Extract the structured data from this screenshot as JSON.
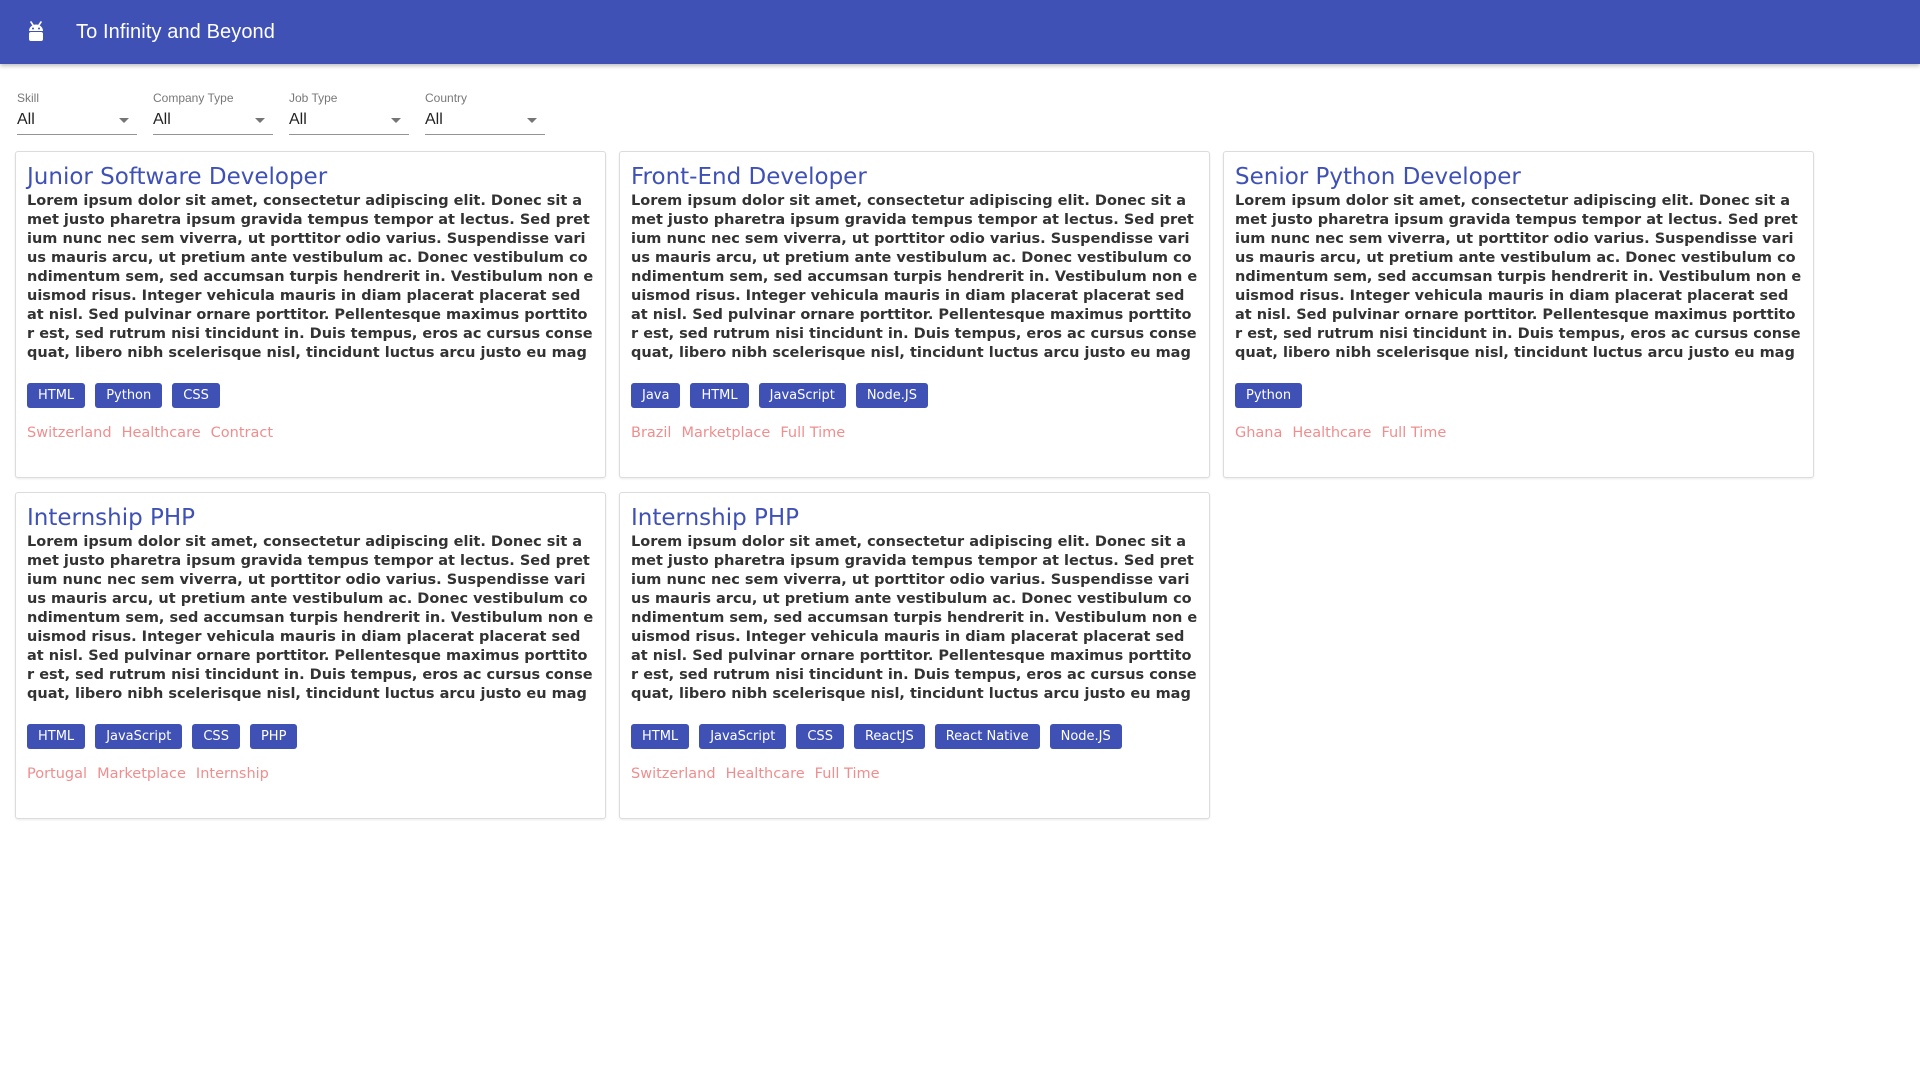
{
  "app": {
    "title": "To Infinity and Beyond",
    "logo_icon": "android-icon",
    "brand_color": "#3f51b5"
  },
  "filters": [
    {
      "label": "Skill",
      "value": "All"
    },
    {
      "label": "Company Type",
      "value": "All"
    },
    {
      "label": "Job Type",
      "value": "All"
    },
    {
      "label": "Country",
      "value": "All"
    }
  ],
  "jobs": [
    {
      "title": "Junior Software Developer",
      "description": "Lorem ipsum dolor sit amet, consectetur adipiscing elit. Donec sit amet justo pharetra ipsum gravida tempus tempor at lectus. Sed pretium nunc nec sem viverra, ut porttitor odio varius. Suspendisse varius mauris arcu, ut pretium ante vestibulum ac. Donec vestibulum condimentum sem, sed accumsan turpis hendrerit in. Vestibulum non euismod risus. Integer vehicula mauris in diam placerat placerat sed at nisl. Sed pulvinar ornare porttitor. Pellentesque maximus porttitor est, sed rutrum nisi tincidunt in. Duis tempus, eros ac cursus consequat, libero nibh scelerisque nisl, tincidunt luctus arcu justo eu magna. Integer ullamcorper risus id mauris malesuada viverra. Sed molestie accumsan sapien nec accumsan. Phasellus a libero arcu.",
      "skills": [
        "HTML",
        "Python",
        "CSS"
      ],
      "country": "Switzerland",
      "company_type": "Healthcare",
      "job_type": "Contract"
    },
    {
      "title": "Front-End Developer",
      "description": "Lorem ipsum dolor sit amet, consectetur adipiscing elit. Donec sit amet justo pharetra ipsum gravida tempus tempor at lectus. Sed pretium nunc nec sem viverra, ut porttitor odio varius. Suspendisse varius mauris arcu, ut pretium ante vestibulum ac. Donec vestibulum condimentum sem, sed accumsan turpis hendrerit in. Vestibulum non euismod risus. Integer vehicula mauris in diam placerat placerat sed at nisl. Sed pulvinar ornare porttitor. Pellentesque maximus porttitor est, sed rutrum nisi tincidunt in. Duis tempus, eros ac cursus consequat, libero nibh scelerisque nisl, tincidunt luctus arcu justo eu magna. Integer ullamcorper risus id mauris malesuada viverra. Sed molestie accumsan sapien nec accumsan. Phasellus a libero arcu.",
      "skills": [
        "Java",
        "HTML",
        "JavaScript",
        "Node.JS"
      ],
      "country": "Brazil",
      "company_type": "Marketplace",
      "job_type": "Full Time"
    },
    {
      "title": "Senior Python Developer",
      "description": "Lorem ipsum dolor sit amet, consectetur adipiscing elit. Donec sit amet justo pharetra ipsum gravida tempus tempor at lectus. Sed pretium nunc nec sem viverra, ut porttitor odio varius. Suspendisse varius mauris arcu, ut pretium ante vestibulum ac. Donec vestibulum condimentum sem, sed accumsan turpis hendrerit in. Vestibulum non euismod risus. Integer vehicula mauris in diam placerat placerat sed at nisl. Sed pulvinar ornare porttitor. Pellentesque maximus porttitor est, sed rutrum nisi tincidunt in. Duis tempus, eros ac cursus consequat, libero nibh scelerisque nisl, tincidunt luctus arcu justo eu magna. Integer ullamcorper risus id mauris malesuada viverra. Sed molestie accumsan sapien nec accumsan. Phasellus a libero arcu.",
      "skills": [
        "Python"
      ],
      "country": "Ghana",
      "company_type": "Healthcare",
      "job_type": "Full Time"
    },
    {
      "title": "Internship PHP",
      "description": "Lorem ipsum dolor sit amet, consectetur adipiscing elit. Donec sit amet justo pharetra ipsum gravida tempus tempor at lectus. Sed pretium nunc nec sem viverra, ut porttitor odio varius. Suspendisse varius mauris arcu, ut pretium ante vestibulum ac. Donec vestibulum condimentum sem, sed accumsan turpis hendrerit in. Vestibulum non euismod risus. Integer vehicula mauris in diam placerat placerat sed at nisl. Sed pulvinar ornare porttitor. Pellentesque maximus porttitor est, sed rutrum nisi tincidunt in. Duis tempus, eros ac cursus consequat, libero nibh scelerisque nisl, tincidunt luctus arcu justo eu magna. Integer ullamcorper risus id mauris malesuada viverra. Sed molestie accumsan sapien nec accumsan. Phasellus a libero arcu.",
      "skills": [
        "HTML",
        "JavaScript",
        "CSS",
        "PHP"
      ],
      "country": "Portugal",
      "company_type": "Marketplace",
      "job_type": "Internship"
    },
    {
      "title": "Internship PHP",
      "description": "Lorem ipsum dolor sit amet, consectetur adipiscing elit. Donec sit amet justo pharetra ipsum gravida tempus tempor at lectus. Sed pretium nunc nec sem viverra, ut porttitor odio varius. Suspendisse varius mauris arcu, ut pretium ante vestibulum ac. Donec vestibulum condimentum sem, sed accumsan turpis hendrerit in. Vestibulum non euismod risus. Integer vehicula mauris in diam placerat placerat sed at nisl. Sed pulvinar ornare porttitor. Pellentesque maximus porttitor est, sed rutrum nisi tincidunt in. Duis tempus, eros ac cursus consequat, libero nibh scelerisque nisl, tincidunt luctus arcu justo eu magna. Integer ullamcorper risus id mauris malesuada viverra. Sed molestie accumsan sapien nec accumsan. Phasellus a libero arcu.",
      "skills": [
        "HTML",
        "JavaScript",
        "CSS",
        "ReactJS",
        "React Native",
        "Node.JS"
      ],
      "country": "Switzerland",
      "company_type": "Healthcare",
      "job_type": "Full Time"
    }
  ]
}
